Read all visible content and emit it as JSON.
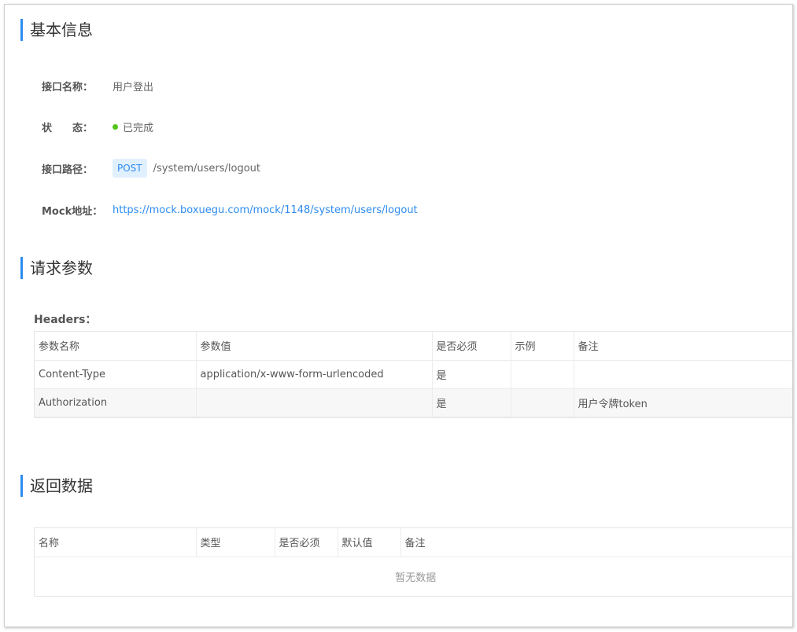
{
  "sections": {
    "basic_info": "基本信息",
    "request_params": "请求参数",
    "response_data": "返回数据"
  },
  "basic_info": {
    "name_label": "接口名称：",
    "name_value": "用户登出",
    "status_label": "状　　态：",
    "status_value": "已完成",
    "status_color": "#52c41a",
    "path_label": "接口路径：",
    "method": "POST",
    "path": "/system/users/logout",
    "mock_label": "Mock地址：",
    "mock_url": "https://mock.boxuegu.com/mock/1148/system/users/logout"
  },
  "headers": {
    "title": "Headers：",
    "columns": [
      "参数名称",
      "参数值",
      "是否必须",
      "示例",
      "备注"
    ],
    "rows": [
      [
        "Content-Type",
        "application/x-www-form-urlencoded",
        "是",
        "",
        ""
      ],
      [
        "Authorization",
        "",
        "是",
        "",
        "用户令牌token"
      ]
    ]
  },
  "response": {
    "columns": [
      "名称",
      "类型",
      "是否必须",
      "默认值",
      "备注"
    ],
    "empty_text": "暂无数据"
  },
  "colors": {
    "accent": "#2d8cf0",
    "method_tag_bg": "#e1f0ff"
  }
}
